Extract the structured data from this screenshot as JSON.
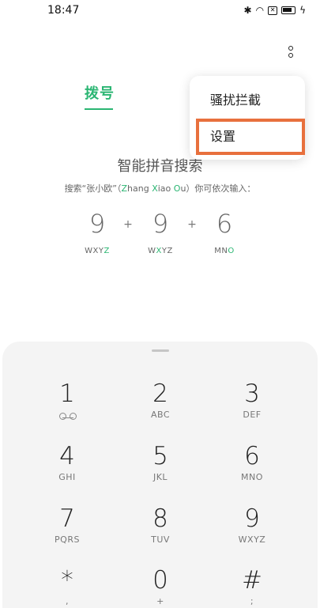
{
  "status": {
    "time": "18:47",
    "icons": [
      "bluetooth-icon",
      "wifi-icon",
      "x-box-icon",
      "battery-icon",
      "charging-icon"
    ]
  },
  "tabs": {
    "dial": "拨号"
  },
  "menu": {
    "items": [
      "骚扰拦截",
      "设置"
    ]
  },
  "hint": {
    "title": "智能拼音搜索",
    "desc_pre": "搜索“张小欧”（",
    "z1": "Z",
    "z2": "hang ",
    "x1": "X",
    "x2": "iao ",
    "o1": "O",
    "o2": "u",
    "desc_post": "）你可依次输入："
  },
  "example": {
    "d1": "9",
    "d2": "9",
    "d3": "6",
    "plus": "+",
    "l1a": "WXY",
    "l1b": "Z",
    "l2a": "W",
    "l2b": "X",
    "l2c": "YZ",
    "l3a": "MN",
    "l3b": "O"
  },
  "keys": [
    {
      "main": "1",
      "sub": ""
    },
    {
      "main": "2",
      "sub": "ABC"
    },
    {
      "main": "3",
      "sub": "DEF"
    },
    {
      "main": "4",
      "sub": "GHI"
    },
    {
      "main": "5",
      "sub": "JKL"
    },
    {
      "main": "6",
      "sub": "MNO"
    },
    {
      "main": "7",
      "sub": "PQRS"
    },
    {
      "main": "8",
      "sub": "TUV"
    },
    {
      "main": "9",
      "sub": "WXYZ"
    },
    {
      "main": "*",
      "sub": ","
    },
    {
      "main": "0",
      "sub": "+"
    },
    {
      "main": "#",
      "sub": ";"
    }
  ],
  "colors": {
    "accent": "#2bb673",
    "highlight_box": "#e8703d",
    "keypad_bg": "#f4f4f4"
  }
}
